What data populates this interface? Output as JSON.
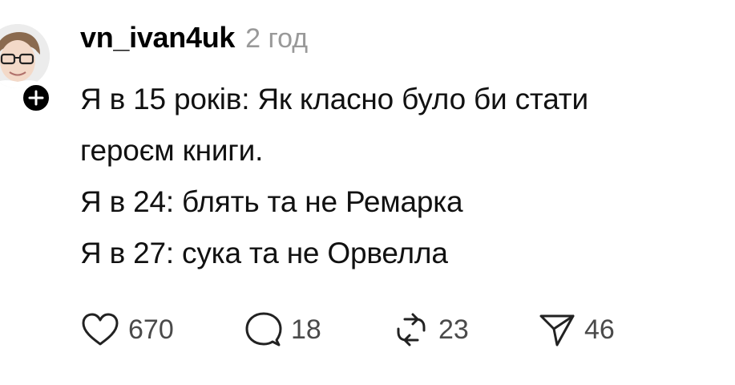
{
  "post": {
    "author": {
      "username": "vn_ivan4uk",
      "avatar_icon": "user-photo-avatar",
      "follow_icon": "plus-icon"
    },
    "timestamp": "2 год",
    "lines": [
      "Я в 15 років: Як класно було би стати",
      "героєм книги.",
      "Я в 24: блять та не Ремарка",
      "Я в 27: сука та не Орвелла"
    ],
    "actions": {
      "likes": "670",
      "replies": "18",
      "reposts": "23",
      "shares": "46"
    },
    "colors": {
      "text": "#111111",
      "muted": "#999999",
      "count": "#4a4a4a",
      "badge": "#000000"
    }
  }
}
